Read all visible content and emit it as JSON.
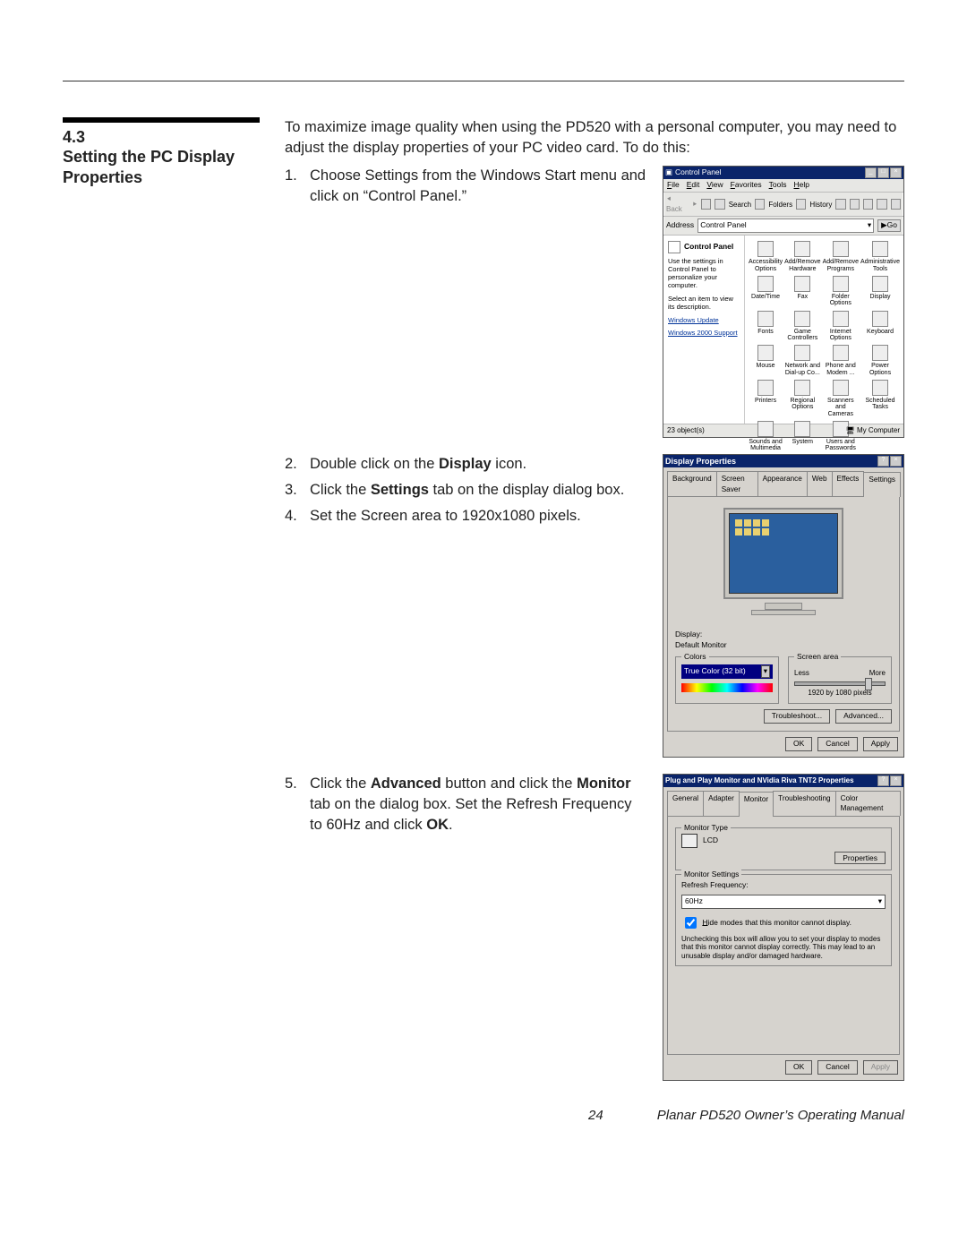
{
  "section": {
    "number": "4.3",
    "title": "Setting the PC Display Properties"
  },
  "intro": "To maximize image quality when using the PD520 with a personal computer, you may need to adjust the display properties of your PC video card. To do this:",
  "steps": {
    "s1": {
      "n": "1.",
      "t": "Choose Settings from the Windows Start menu and click on “Control Panel.”"
    },
    "s2": {
      "n": "2.",
      "pre": "Double click on the ",
      "b": "Display",
      "post": " icon."
    },
    "s3": {
      "n": "3.",
      "pre": "Click the ",
      "b": "Settings",
      "post": " tab on the display dialog box."
    },
    "s4": {
      "n": "4.",
      "t": "Set the Screen area to 1920x1080 pixels."
    },
    "s5": {
      "n": "5.",
      "pre": "Click the ",
      "b": "Advanced",
      "mid": " button and click the ",
      "b2": "Monitor",
      "mid2": " tab on the dialog box. Set the Refresh Frequency to 60Hz and click ",
      "b3": "OK",
      "post": "."
    }
  },
  "controlPanel": {
    "title": "Control Panel",
    "menus": [
      "File",
      "Edit",
      "View",
      "Favorites",
      "Tools",
      "Help"
    ],
    "tbBack": "Back",
    "tbSearch": "Search",
    "tbFolders": "Folders",
    "tbHistory": "History",
    "addrLabel": "Address",
    "addrValue": "Control Panel",
    "go": "Go",
    "sideTitle": "Control Panel",
    "sideDesc": "Use the settings in Control Panel to personalize your computer.",
    "sideDesc2": "Select an item to view its description.",
    "links": [
      "Windows Update",
      "Windows 2000 Support"
    ],
    "items": [
      "Accessibility Options",
      "Add/Remove Hardware",
      "Add/Remove Programs",
      "Administrative Tools",
      "Date/Time",
      "Fax",
      "Folder Options",
      "Display",
      "Fonts",
      "Game Controllers",
      "Internet Options",
      "Keyboard",
      "Mouse",
      "Network and Dial-up Co...",
      "Phone and Modem ...",
      "Power Options",
      "Printers",
      "Regional Options",
      "Scanners and Cameras",
      "Scheduled Tasks",
      "Sounds and Multimedia",
      "System",
      "Users and Passwords"
    ],
    "statusLeft": "23 object(s)",
    "statusRight": "My Computer"
  },
  "displayDlg": {
    "title": "Display Properties",
    "tabs": [
      "Background",
      "Screen Saver",
      "Appearance",
      "Web",
      "Effects",
      "Settings"
    ],
    "displayLabel": "Display:",
    "displayValue": "Default Monitor",
    "colorsGroup": "Colors",
    "colorsValue": "True Color (32 bit)",
    "areaGroup": "Screen area",
    "less": "Less",
    "more": "More",
    "areaValue": "1920 by 1080 pixels",
    "troubleshoot": "Troubleshoot...",
    "advanced": "Advanced...",
    "ok": "OK",
    "cancel": "Cancel",
    "apply": "Apply"
  },
  "monitorDlg": {
    "title": "Plug and Play Monitor and NVidia Riva TNT2 Properties",
    "tabs": [
      "General",
      "Adapter",
      "Monitor",
      "Troubleshooting",
      "Color Management"
    ],
    "typeGroup": "Monitor Type",
    "typeValue": "LCD",
    "properties": "Properties",
    "settingsGroup": "Monitor Settings",
    "refreshLabel": "Refresh Frequency:",
    "refreshValue": "60Hz",
    "hideLabel": "Hide modes that this monitor cannot display.",
    "warning": "Unchecking this box will allow you to set your display to modes that this monitor cannot display correctly. This may lead to an unusable display and/or damaged hardware.",
    "ok": "OK",
    "cancel": "Cancel",
    "apply": "Apply"
  },
  "footer": {
    "page": "24",
    "manual": "Planar PD520 Owner’s Operating Manual"
  }
}
